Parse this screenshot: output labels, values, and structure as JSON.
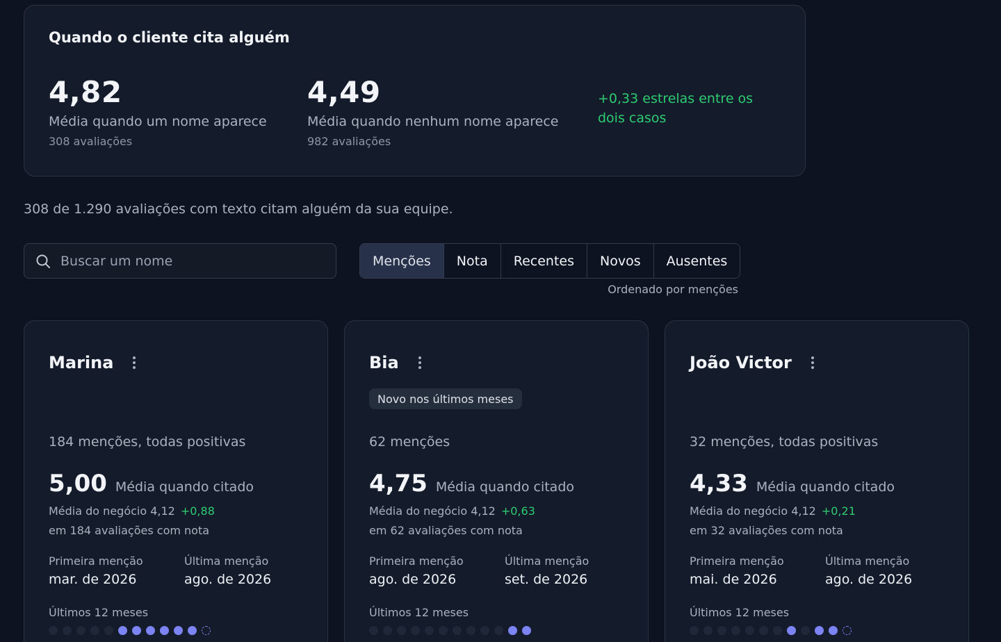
{
  "summary": {
    "title": "Quando o cliente cita alguém",
    "with_name": {
      "value": "4,82",
      "label": "Média quando um nome aparece",
      "count": "308 avaliações"
    },
    "without_name": {
      "value": "4,49",
      "label": "Média quando nenhum nome aparece",
      "count": "982 avaliações"
    },
    "difference": "+0,33 estrelas entre os dois casos"
  },
  "intro": "308 de 1.290 avaliações com texto citam alguém da sua equipe.",
  "search": {
    "placeholder": "Buscar um nome",
    "value": ""
  },
  "tabs": [
    {
      "label": "Menções",
      "active": true
    },
    {
      "label": "Nota",
      "active": false
    },
    {
      "label": "Recentes",
      "active": false
    },
    {
      "label": "Novos",
      "active": false
    },
    {
      "label": "Ausentes",
      "active": false
    }
  ],
  "sort_note": "Ordenado por menções",
  "labels": {
    "avg_cited": "Média quando citado",
    "first_mention": "Primeira menção",
    "last_mention": "Última menção",
    "last_12_months": "Últimos 12 meses"
  },
  "colors": {
    "positive": "#2ecc71",
    "accent": "#7c83f2",
    "background": "#0d1321",
    "card": "#141c2b"
  },
  "people": [
    {
      "name": "Marina",
      "badge": "",
      "mentions": "184 menções, todas positivas",
      "avg": "5,00",
      "business_avg": "Média do negócio 4,12",
      "delta": "+0,88",
      "count": "em 184 avaliações com nota",
      "first": "mar. de 2026",
      "last": "ago. de 2026",
      "months": [
        "off",
        "off",
        "off",
        "off",
        "off",
        "on",
        "on",
        "on",
        "on",
        "on",
        "on",
        "partial"
      ]
    },
    {
      "name": "Bia",
      "badge": "Novo nos últimos meses",
      "mentions": "62 menções",
      "avg": "4,75",
      "business_avg": "Média do negócio 4,12",
      "delta": "+0,63",
      "count": "em 62 avaliações com nota",
      "first": "ago. de 2026",
      "last": "set. de 2026",
      "months": [
        "off",
        "off",
        "off",
        "off",
        "off",
        "off",
        "off",
        "off",
        "off",
        "off",
        "on",
        "on"
      ]
    },
    {
      "name": "João Victor",
      "badge": "",
      "mentions": "32 menções, todas positivas",
      "avg": "4,33",
      "business_avg": "Média do negócio 4,12",
      "delta": "+0,21",
      "count": "em 32 avaliações com nota",
      "first": "mai. de 2026",
      "last": "ago. de 2026",
      "months": [
        "off",
        "off",
        "off",
        "off",
        "off",
        "off",
        "off",
        "on",
        "off",
        "on",
        "on",
        "partial"
      ]
    }
  ]
}
